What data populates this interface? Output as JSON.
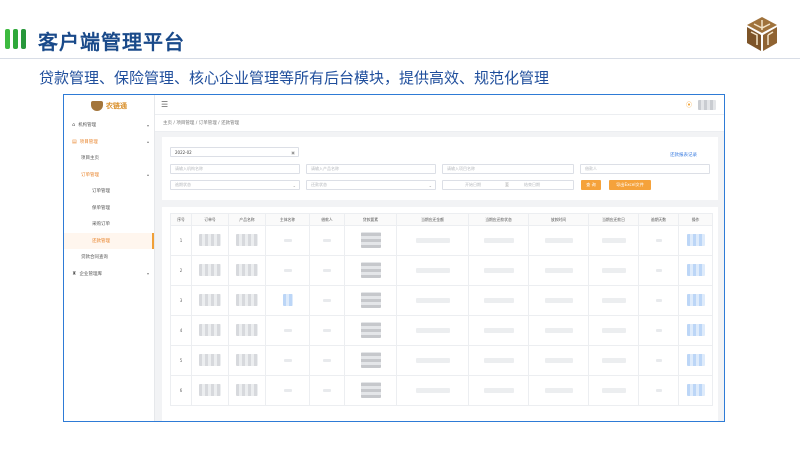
{
  "slide": {
    "title": "客户端管理平台",
    "subtitle": "贷款管理、保险管理、核心企业管理等所有后台模块，提供高效、规范化管理"
  },
  "app": {
    "logo_text": "农链通",
    "sidebar": [
      {
        "label": "机构管理",
        "icon": "home-icon",
        "level": 0,
        "arrow": "▾",
        "state": ""
      },
      {
        "label": "项目管理",
        "icon": "folder-icon",
        "level": 0,
        "arrow": "▴",
        "state": "open"
      },
      {
        "label": "项目主页",
        "icon": "",
        "level": 1,
        "arrow": "",
        "state": ""
      },
      {
        "label": "订单管理",
        "icon": "",
        "level": 1,
        "arrow": "▴",
        "state": "open"
      },
      {
        "label": "订单管理",
        "icon": "",
        "level": 2,
        "arrow": "",
        "state": ""
      },
      {
        "label": "保单管理",
        "icon": "",
        "level": 2,
        "arrow": "",
        "state": ""
      },
      {
        "label": "采购订单",
        "icon": "",
        "level": 2,
        "arrow": "",
        "state": ""
      },
      {
        "label": "还款管理",
        "icon": "",
        "level": 2,
        "arrow": "",
        "state": "active"
      },
      {
        "label": "贷款合同查询",
        "icon": "",
        "level": 1,
        "arrow": "",
        "state": ""
      },
      {
        "label": "企业管理库",
        "icon": "building-icon",
        "level": 0,
        "arrow": "▾",
        "state": ""
      }
    ],
    "breadcrumb": "主页 / 项目管理 / 订单管理 / 还款管理",
    "filters": {
      "date_value": "2022-02",
      "record_link": "还款报表记录",
      "row1": [
        "请输入机构名称",
        "请输入产品名称",
        "请输入项目名称",
        "借款人"
      ],
      "row2": [
        "逾期状态",
        "还款状态",
        "开始日期",
        "结束日期"
      ],
      "range_separator": "至",
      "search_label": "查 询",
      "export_label": "导出Excel文件"
    },
    "table": {
      "headers": [
        "序号",
        "订单号",
        "产品名称",
        "主体名称",
        "借款人",
        "贷款要素",
        "当期应还金额",
        "当期应还款状态",
        "放款时间",
        "当期应还款日",
        "逾期天数",
        "操作"
      ],
      "rows": [
        "1",
        "2",
        "3",
        "4",
        "5",
        "6"
      ]
    }
  }
}
